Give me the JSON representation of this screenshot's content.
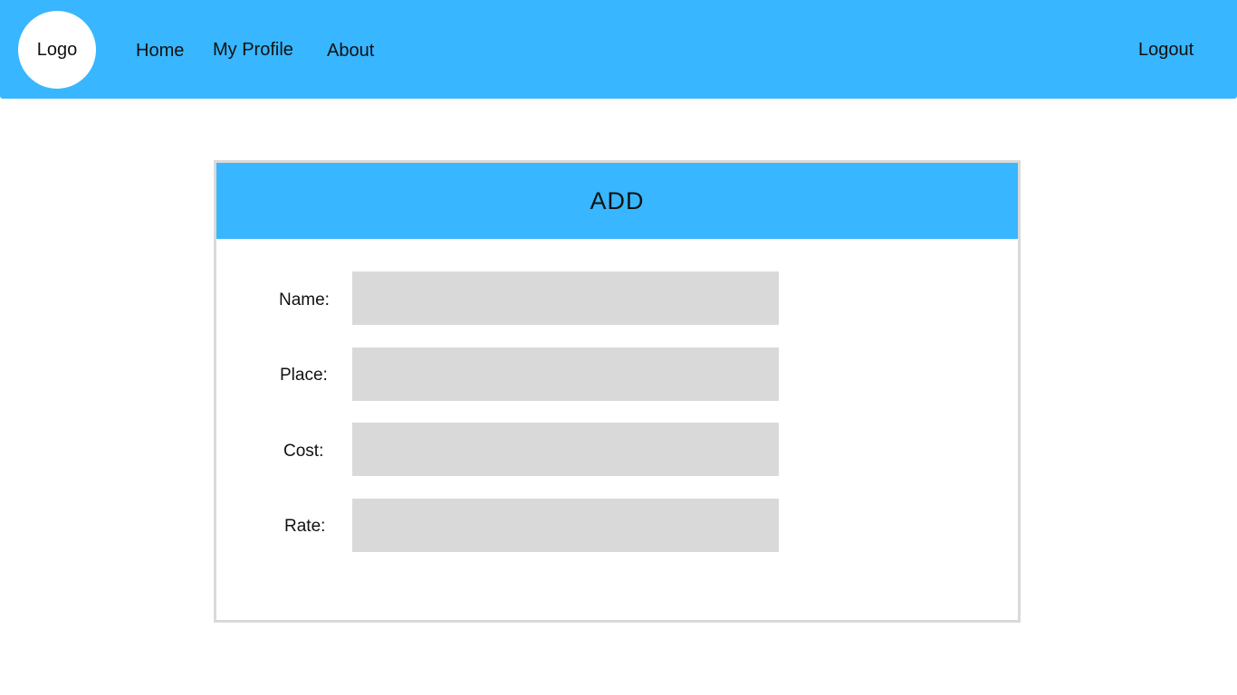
{
  "navbar": {
    "logo_label": "Logo",
    "links": [
      {
        "label": "Home"
      },
      {
        "label": "My Profile"
      },
      {
        "label": "About"
      }
    ],
    "logout_label": "Logout"
  },
  "form": {
    "title": "ADD",
    "fields": [
      {
        "label": "Name:",
        "value": "",
        "placeholder": ""
      },
      {
        "label": "Place:",
        "value": "",
        "placeholder": ""
      },
      {
        "label": "Cost:",
        "value": "",
        "placeholder": ""
      },
      {
        "label": "Rate:",
        "value": "",
        "placeholder": ""
      }
    ]
  },
  "colors": {
    "accent": "#38b6ff",
    "input_bg": "#d9d9d9",
    "card_border": "#d9d9d9"
  }
}
